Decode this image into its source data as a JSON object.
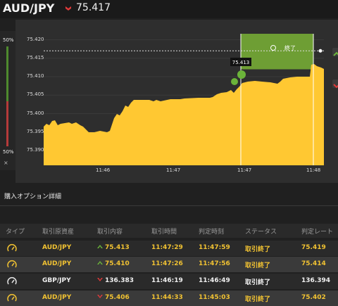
{
  "header": {
    "pair": "AUD/JPY",
    "price": "75.417"
  },
  "sidebar": {
    "top_pct": "50%",
    "bottom_pct": "50%",
    "close": "×"
  },
  "chart_data": {
    "type": "area",
    "y_ticks": [
      "75.420",
      "75.415",
      "75.410",
      "75.405",
      "75.400",
      "75.395",
      "75.390"
    ],
    "ylim": [
      75.386,
      75.422
    ],
    "x_ticks": [
      "11:46",
      "11:47",
      "11:47",
      "11:48"
    ],
    "current_level": 75.417,
    "marker_label": "75.413",
    "finish_label": "終了",
    "colors": {
      "area": "#ffc832",
      "win_zone": "#6e9e34",
      "entry": "#6bb33a"
    }
  },
  "section": {
    "title": "購入オプション詳細"
  },
  "table": {
    "headers": [
      "タイプ",
      "取引原資産",
      "取引内容",
      "取引時間",
      "判定時刻",
      "ステータス",
      "判定レート"
    ],
    "rows": [
      {
        "asset": "AUD/JPY",
        "dir": "up",
        "rate": "75.413",
        "time": "11:47:29",
        "judge": "11:47:59",
        "status": "取引終了",
        "final": "75.419",
        "tone": "gold"
      },
      {
        "asset": "AUD/JPY",
        "dir": "up",
        "rate": "75.410",
        "time": "11:47:26",
        "judge": "11:47:56",
        "status": "取引終了",
        "final": "75.414",
        "tone": "gold"
      },
      {
        "asset": "GBP/JPY",
        "dir": "down",
        "rate": "136.383",
        "time": "11:46:19",
        "judge": "11:46:49",
        "status": "取引終了",
        "final": "136.394",
        "tone": "white"
      },
      {
        "asset": "AUD/JPY",
        "dir": "down",
        "rate": "75.406",
        "time": "11:44:33",
        "judge": "11:45:03",
        "status": "取引終了",
        "final": "75.402",
        "tone": "gold"
      }
    ]
  }
}
